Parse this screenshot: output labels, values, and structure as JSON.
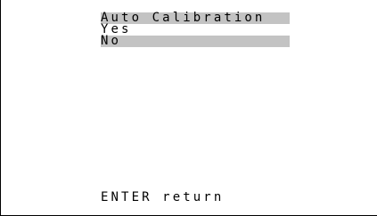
{
  "menu": {
    "title": "Auto Calibration",
    "options": [
      {
        "label": "Yes",
        "selected": false
      },
      {
        "label": "No",
        "selected": true
      }
    ]
  },
  "footer": {
    "hint": "ENTER return"
  },
  "colors": {
    "highlight": "#c3c3c3",
    "text": "#000000",
    "background": "#ffffff"
  }
}
